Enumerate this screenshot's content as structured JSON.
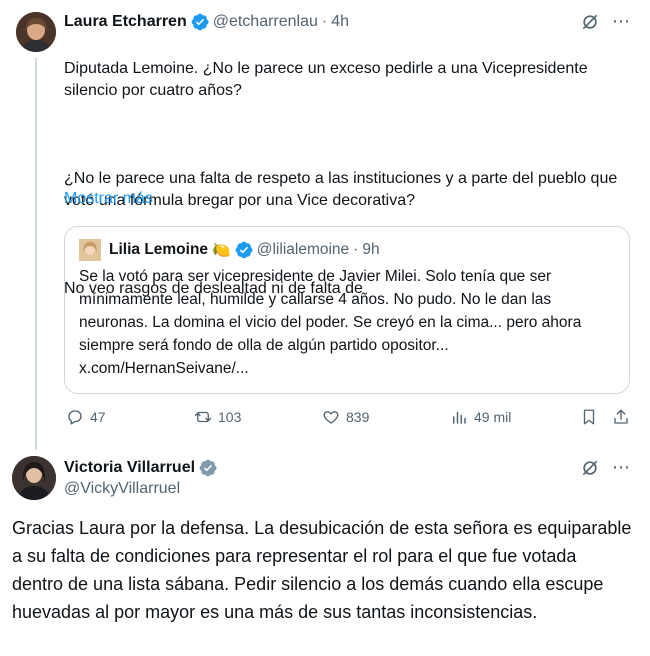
{
  "tweet1": {
    "name": "Laura Etcharren",
    "handle": "@etcharrenlau",
    "dot": "·",
    "time": "4h",
    "p1": "Diputada Lemoine. ¿No le parece un exceso pedirle a una Vicepresidente silencio por cuatro años?",
    "p2": "¿No le parece una falta de respeto a las instituciones y a parte del pueblo que votó una fórmula bregar por una Vice decorativa?",
    "p3": "No veo rasgos de deslealtad ni de falta de",
    "show_more": "Mostrar más",
    "quote": {
      "name": "Lilia Lemoine",
      "emoji": "🍋",
      "handle": "@lilialemoine",
      "dot": "·",
      "time": "9h",
      "text": "Se la votó para ser vicepresidente de Javier Milei. Solo tenía que ser mínimamente leal, humilde y callarse 4 años. No pudo. No le dan las neuronas. La domina el vicio del poder. Se creyó en la cima... pero ahora siempre será fondo de  olla de algún partido opositor...",
      "link": "x.com/HernanSeivane/..."
    },
    "actions": {
      "replies": "47",
      "reposts": "103",
      "likes": "839",
      "views": "49 mil"
    }
  },
  "tweet2": {
    "name": "Victoria Villarruel",
    "handle": "@VickyVillarruel",
    "text": "Gracias Laura por la defensa. La desubicación de esta señora es equiparable a su falta de condiciones para representar el rol para el que fue votada dentro de una lista sábana. Pedir silencio a los demás cuando ella escupe huevadas al por mayor es una más de sus tantas inconsistencias."
  },
  "icons": {
    "more": "⋯"
  },
  "colors": {
    "verified": "#1d9bf0",
    "link": "#1d9bf0",
    "secondary": "#536471"
  }
}
